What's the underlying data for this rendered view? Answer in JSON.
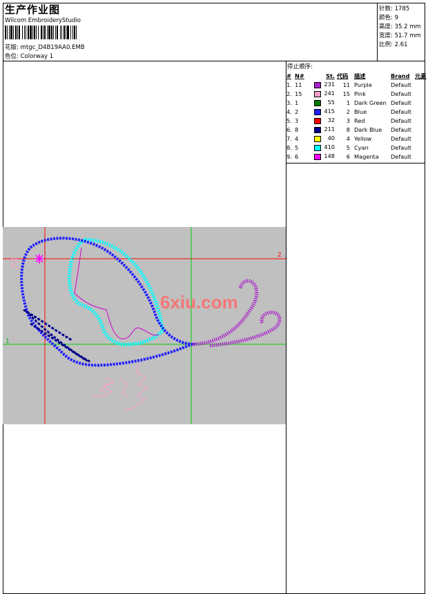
{
  "header": {
    "title": "生产作业图",
    "software": "Wilcom EmbroideryStudio",
    "design_label": "花版:",
    "design_value": "mtgc_D4B19AA0.EMB",
    "colorway_label": "色位:",
    "colorway_value": "Colorway 1"
  },
  "stats": [
    {
      "label": "针数:",
      "value": "1785"
    },
    {
      "label": "颜色:",
      "value": "9"
    },
    {
      "label": "高度:",
      "value": "35.2 mm"
    },
    {
      "label": "宽度:",
      "value": "51.7 mm"
    },
    {
      "label": "比例:",
      "value": "2.61"
    }
  ],
  "stop_sequence": {
    "title": "停止顺序:",
    "columns": [
      "#",
      "N#",
      "St.",
      "代码",
      "描述",
      "Brand",
      "元素"
    ],
    "rows": [
      {
        "idx": "1.",
        "n": "11",
        "color": "#aa22cc",
        "st": "231",
        "code": "11",
        "desc": "Purple",
        "brand": "Default"
      },
      {
        "idx": "2.",
        "n": "15",
        "color": "#f4a0c8",
        "st": "241",
        "code": "15",
        "desc": "Pink",
        "brand": "Default"
      },
      {
        "idx": "3.",
        "n": "1",
        "color": "#007a00",
        "st": "55",
        "code": "1",
        "desc": "Dark Green",
        "brand": "Default"
      },
      {
        "idx": "4.",
        "n": "2",
        "color": "#1f1fff",
        "st": "415",
        "code": "2",
        "desc": "Blue",
        "brand": "Default"
      },
      {
        "idx": "5.",
        "n": "3",
        "color": "#ff0000",
        "st": "32",
        "code": "3",
        "desc": "Red",
        "brand": "Default"
      },
      {
        "idx": "6.",
        "n": "8",
        "color": "#00008b",
        "st": "211",
        "code": "8",
        "desc": "Dark Blue",
        "brand": "Default"
      },
      {
        "idx": "7.",
        "n": "4",
        "color": "#ffff00",
        "st": "40",
        "code": "4",
        "desc": "Yellow",
        "brand": "Default"
      },
      {
        "idx": "8.",
        "n": "5",
        "color": "#00ffff",
        "st": "410",
        "code": "5",
        "desc": "Cyan",
        "brand": "Default"
      },
      {
        "idx": "9.",
        "n": "6",
        "color": "#ff00ff",
        "st": "148",
        "code": "6",
        "desc": "Magenta",
        "brand": "Default"
      }
    ]
  },
  "preview": {
    "background": "#c0c0c0",
    "watermark": "6xiu.com",
    "axis_labels": {
      "horizontal": "2",
      "vertical": "1"
    }
  }
}
